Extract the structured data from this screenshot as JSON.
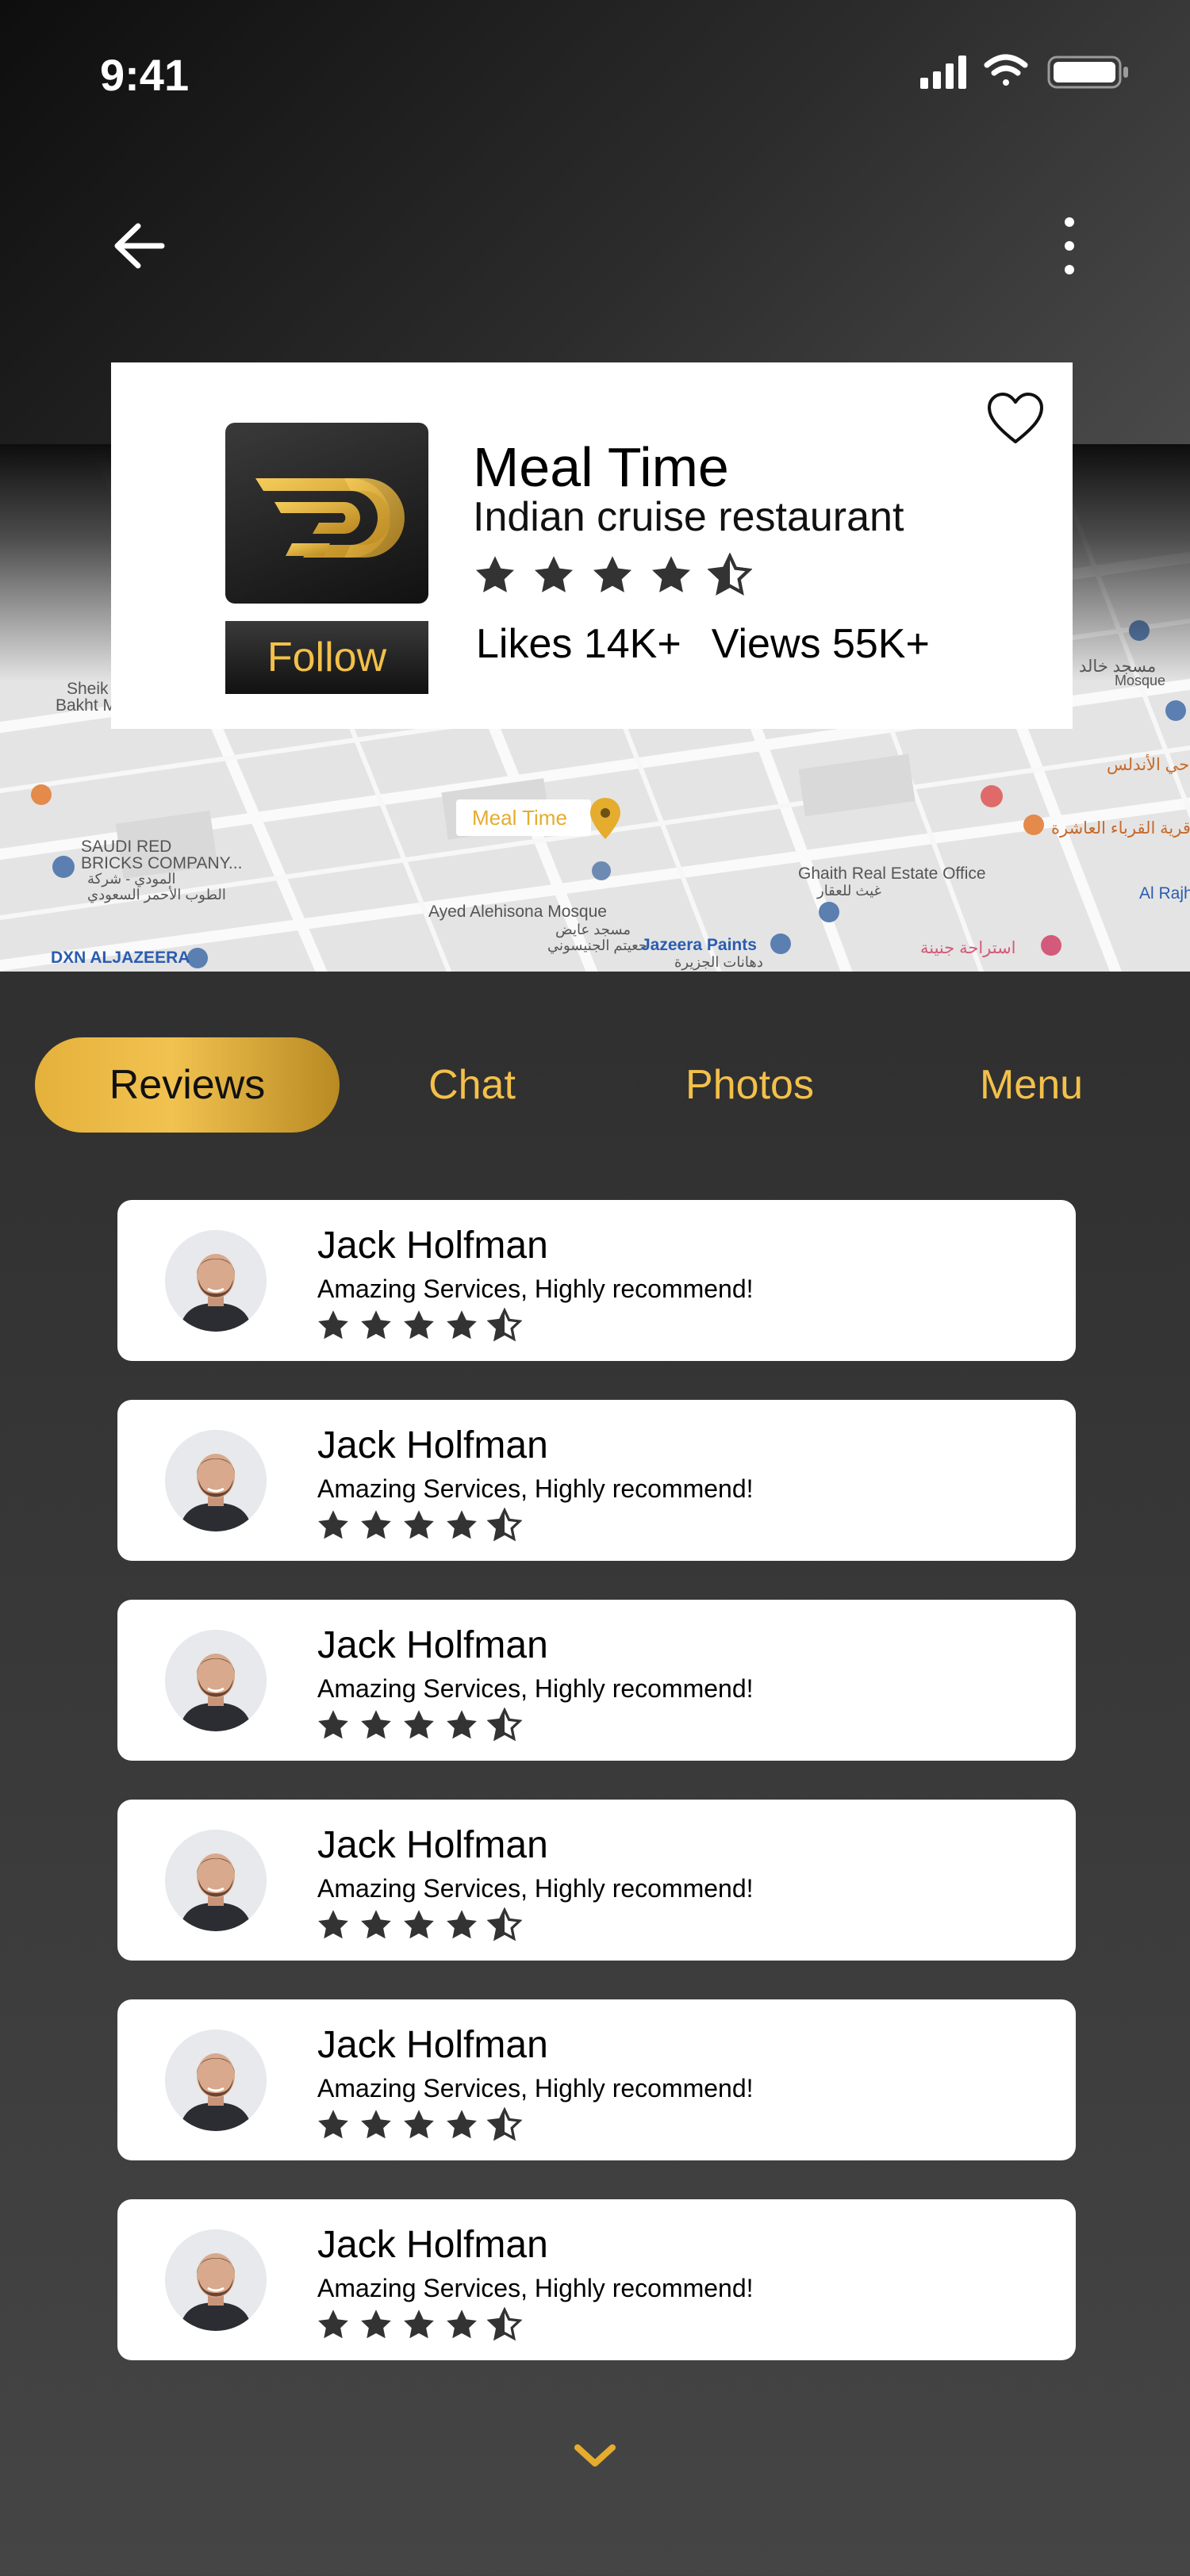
{
  "status_bar": {
    "time": "9:41"
  },
  "restaurant": {
    "name": "Meal Time",
    "subtitle": "Indian cruise restaurant",
    "rating": 4.5,
    "follow_label": "Follow",
    "likes": "Likes 14K+",
    "views": "Views 55K+"
  },
  "map": {
    "pin_label": "Meal Time",
    "labels": {
      "saudi_red": "SAUDI RED",
      "bricks": "BRICKS COMPANY...",
      "saudi_ar": "المودي - شركة",
      "bricks_ar": "الطوب الأحمر السعودي",
      "ayed": "Ayed Alehisona Mosque",
      "ayed_ar1": "مسجد عايض",
      "ayed_ar2": "حعيتم الجنيسوني",
      "jazeera": "Jazeera Paints",
      "jazeera_ar": "دهانات الجزيرة",
      "ghaith": "Ghaith Real Estate Office",
      "ghaith_ar": "غيث للعقار",
      "dxn": "DXN ALJAZEERA",
      "alraj": "Al Rajh",
      "rest_ar": "استراحة جنينة",
      "ashira": "قرية القرباء العاشرة",
      "andalus": "حي الأندلس",
      "mosque": "مسجد خالد",
      "mosque_en": "Mosque",
      "sheik": "Sheik",
      "bakht": "Bakht M"
    }
  },
  "tabs": [
    {
      "label": "Reviews",
      "active": true
    },
    {
      "label": "Chat",
      "active": false
    },
    {
      "label": "Photos",
      "active": false
    },
    {
      "label": "Menu",
      "active": false
    }
  ],
  "reviews": [
    {
      "name": "Jack Holfman",
      "text": "Amazing Services, Highly recommend!",
      "rating": 4.5
    },
    {
      "name": "Jack Holfman",
      "text": "Amazing Services, Highly recommend!",
      "rating": 4.5
    },
    {
      "name": "Jack Holfman",
      "text": "Amazing Services, Highly recommend!",
      "rating": 4.5
    },
    {
      "name": "Jack Holfman",
      "text": "Amazing Services, Highly recommend!",
      "rating": 4.5
    },
    {
      "name": "Jack Holfman",
      "text": "Amazing Services, Highly recommend!",
      "rating": 4.5
    },
    {
      "name": "Jack Holfman",
      "text": "Amazing Services, Highly recommend!",
      "rating": 4.5
    }
  ],
  "colors": {
    "accent": "#f3c04a",
    "star": "#333333",
    "card": "#ffffff"
  },
  "icons": [
    "signal-icon",
    "wifi-icon",
    "battery-icon",
    "back-arrow-icon",
    "more-vertical-icon",
    "heart-icon",
    "logo-icon",
    "map-pin-icon",
    "star-icon",
    "chevron-down-icon"
  ]
}
